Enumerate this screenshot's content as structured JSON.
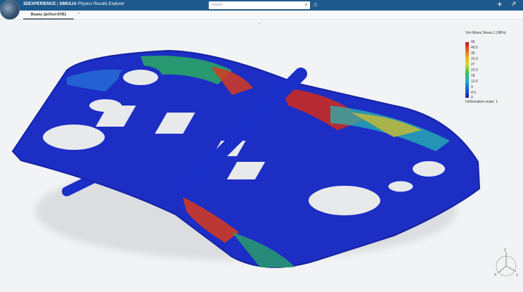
{
  "header": {
    "brand": "3DEXPERIENCE",
    "separator": " | ",
    "product": "SIMULIA",
    "app": "Physics Results Explorer",
    "search_placeholder": "Search",
    "add_label": "+",
    "share_label": "⇗"
  },
  "tabs": [
    {
      "label": "Beamy-3ptTest-NTB1",
      "active": true
    }
  ],
  "tab_add": "+",
  "legend": {
    "title": "Von Mises Stress.1 (MPa)",
    "ticks": [
      "45",
      "40.5",
      "36",
      "31.5",
      "27",
      "22.5",
      "18",
      "13.5",
      "9",
      "4.5",
      "0"
    ],
    "deformation_label": "Deformation scale: 1"
  },
  "triad": {
    "x": "X",
    "y": "Y",
    "z": "Z"
  }
}
